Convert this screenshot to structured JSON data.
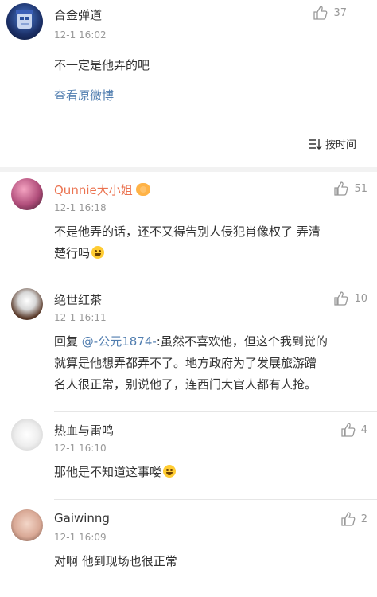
{
  "post": {
    "author": "合金弹道",
    "time": "12-1 16:02",
    "likes": "37",
    "text": "不一定是他弄的吧",
    "view_original": "查看原微博",
    "sort_label": "按时间"
  },
  "comments": [
    {
      "author": "Qunnie大小姐",
      "time": "12-1 16:18",
      "likes": "51",
      "lines": [
        "不是他弄的话，还不又得告别人侵犯肖像权了 弄清",
        "楚行吗"
      ]
    },
    {
      "author": "绝世红茶",
      "time": "12-1 16:11",
      "likes": "10",
      "reply_prefix": "回复 ",
      "mention": "@-公元1874-",
      "lines": [
        ":虽然不喜欢他，但这个我到觉的",
        "就算是他想弄都弄不了。地方政府为了发展旅游蹭",
        "名人很正常，别说他了，连西门大官人都有人抢。"
      ]
    },
    {
      "author": "热血与雷鸣",
      "time": "12-1 16:10",
      "likes": "4",
      "lines": [
        "那他是不知道这事喽"
      ]
    },
    {
      "author": "Gaiwinng",
      "time": "12-1 16:09",
      "likes": "2",
      "lines": [
        "对啊 他到现场也很正常"
      ]
    }
  ],
  "colors": {
    "orange_name": "#eb7350",
    "link_blue": "#507daf",
    "muted": "#999999"
  }
}
